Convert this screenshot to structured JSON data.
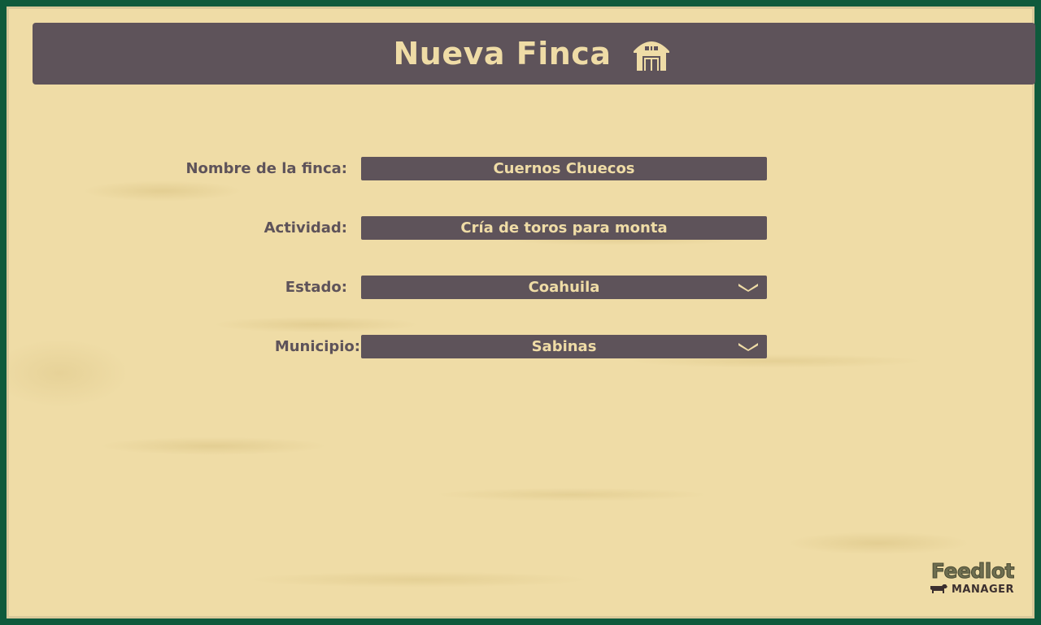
{
  "header": {
    "title": "Nueva Finca",
    "icon": "barn-icon"
  },
  "form": {
    "fields": [
      {
        "label": "Nombre de la finca:",
        "value": "Cuernos Chuecos",
        "type": "text"
      },
      {
        "label": "Actividad:",
        "value": "Cría de toros para monta",
        "type": "text"
      },
      {
        "label": "Estado:",
        "value": "Coahuila",
        "type": "select"
      },
      {
        "label": "Municipio:",
        "value": "Sabinas",
        "type": "select"
      }
    ]
  },
  "logo": {
    "line1": "Feedlot",
    "line2": "MANAGER"
  },
  "colors": {
    "background": "#efdca6",
    "panel": "#5e535a",
    "border": "#0f5a3c",
    "text_light": "#efdca6"
  }
}
